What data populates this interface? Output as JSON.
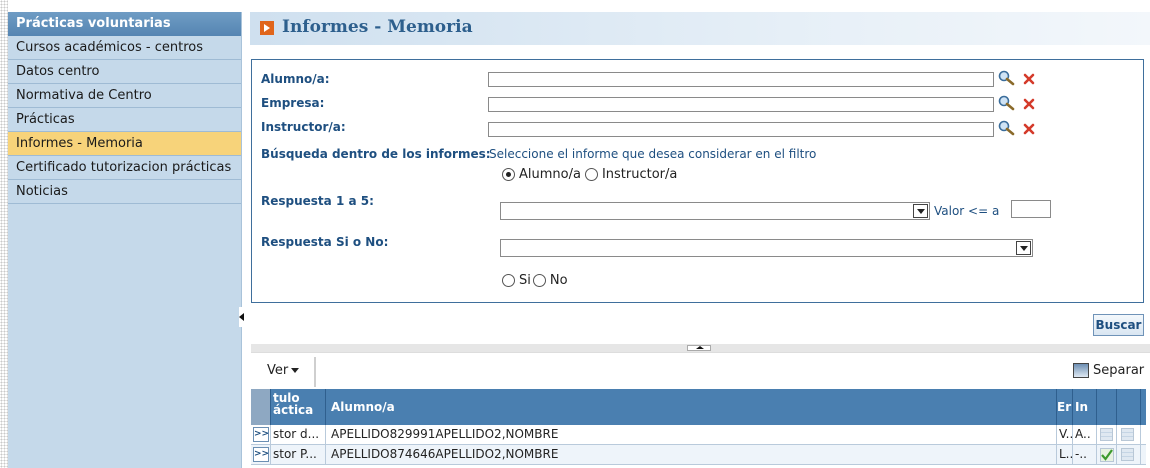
{
  "sidebar": {
    "title": "Prácticas voluntarias",
    "items": [
      {
        "label": "Cursos académicos - centros"
      },
      {
        "label": "Datos centro"
      },
      {
        "label": "Normativa de Centro"
      },
      {
        "label": "Prácticas"
      },
      {
        "label": "Informes - Memoria",
        "active": true
      },
      {
        "label": "Certificado tutorizacion prácticas"
      },
      {
        "label": "Noticias"
      }
    ]
  },
  "header": {
    "title": "Informes - Memoria"
  },
  "filters": {
    "alumno_label": "Alumno/a:",
    "empresa_label": "Empresa:",
    "instructor_label": "Instructor/a:",
    "alumno_value": "",
    "empresa_value": "",
    "instructor_value": "",
    "busqueda_label": "Búsqueda dentro de los informes:",
    "busqueda_hint": "Seleccione el informe que desea considerar en el filtro",
    "report_options": [
      {
        "label": "Alumno/a",
        "checked": true
      },
      {
        "label": "Instructor/a",
        "checked": false
      }
    ],
    "respuesta15_label": "Respuesta 1 a 5:",
    "respuesta15_selected": "",
    "valor_label": "Valor <= a",
    "valor_value": "",
    "respuestasino_label": "Respuesta Si o No:",
    "respuestasino_selected": "",
    "sino_options": [
      {
        "label": "Si",
        "checked": false
      },
      {
        "label": "No",
        "checked": false
      }
    ]
  },
  "actions": {
    "search_label": "Buscar"
  },
  "toolbar": {
    "ver_label": "Ver",
    "separar_label": "Separar"
  },
  "grid": {
    "columns": [
      "",
      "tulo\náctica",
      "Alumno/a",
      "Er",
      "In",
      "",
      ""
    ],
    "rows": [
      {
        "expander": ">>",
        "titulo": "stor d...",
        "alumno": "APELLIDO829991APELLIDO2,NOMBRE",
        "er": "V..",
        "in": "A..",
        "checked": false
      },
      {
        "expander": ">>",
        "titulo": "stor P...",
        "alumno": "APELLIDO874646APELLIDO2,NOMBRE",
        "er": "L..",
        "in": "-..",
        "checked": true
      }
    ]
  },
  "colors": {
    "accent": "#2d5f8d",
    "sidebar_bg": "#c5d9ea",
    "active_item": "#f7d37a",
    "grid_header": "#4a7fb0",
    "close_red": "#d43a2a"
  }
}
